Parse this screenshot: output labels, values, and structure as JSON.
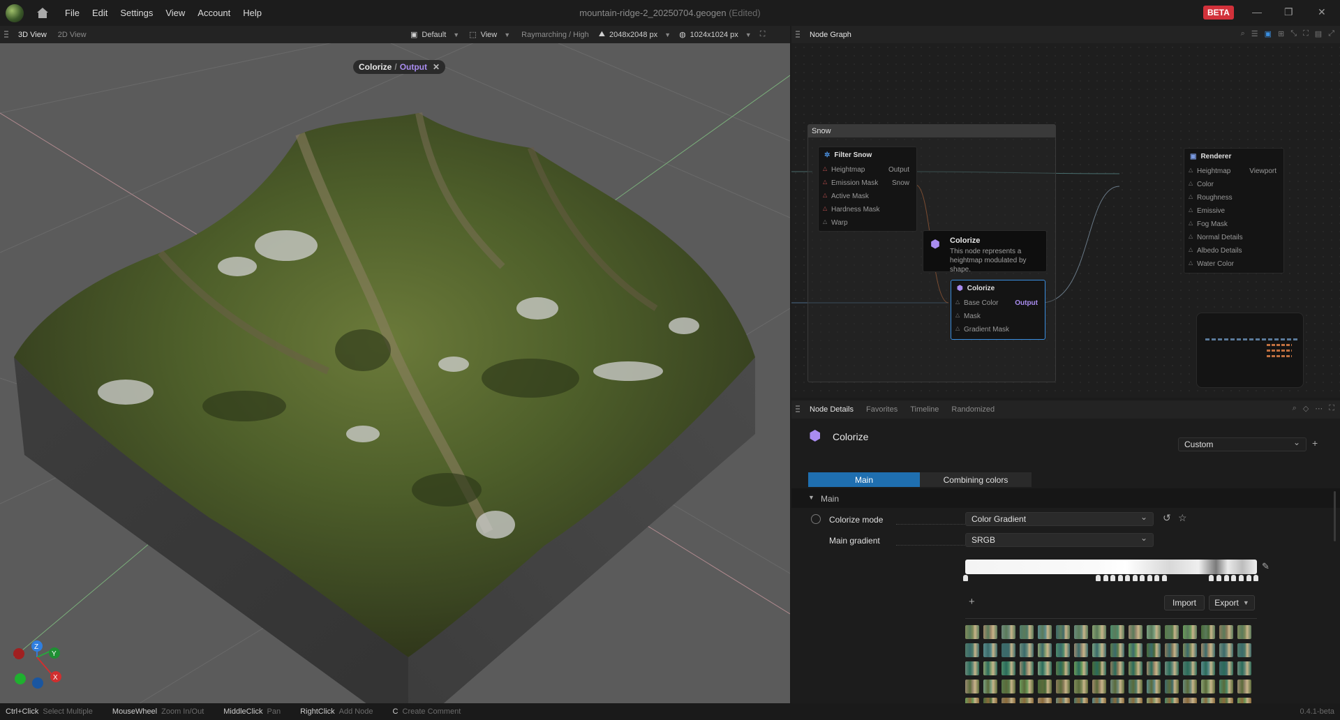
{
  "menu": {
    "items": [
      "File",
      "Edit",
      "Settings",
      "View",
      "Account",
      "Help"
    ]
  },
  "title": {
    "file": "mountain-ridge-2_20250704.geogen",
    "status": "(Edited)"
  },
  "badge": "BETA",
  "viewport": {
    "tabs": [
      "3D View",
      "2D View"
    ],
    "preset": "Default",
    "view": "View",
    "render_mode": "Raymarching / High",
    "resolution": "2048x2048 px",
    "output_res": "1024x1024 px",
    "chip": {
      "node": "Colorize",
      "sep": "/",
      "port": "Output"
    },
    "axes": {
      "z": "Z",
      "y": "Y",
      "x": "X"
    }
  },
  "nodegraph": {
    "tab": "Node Graph",
    "frame": "Snow",
    "filter_snow": {
      "title": "Filter Snow",
      "ports": [
        "Heightmap",
        "Emission Mask",
        "Active Mask",
        "Hardness Mask",
        "Warp"
      ],
      "outputs": [
        "Output",
        "Snow"
      ]
    },
    "tooltip": {
      "title": "Colorize",
      "desc": "This node represents a heightmap modulated by shape."
    },
    "colorize": {
      "title": "Colorize",
      "ports": [
        "Base Color",
        "Mask",
        "Gradient Mask"
      ],
      "output": "Output"
    },
    "renderer": {
      "title": "Renderer",
      "ports": [
        "Heightmap",
        "Color",
        "Roughness",
        "Emissive",
        "Fog Mask",
        "Normal Details",
        "Albedo Details",
        "Water Color"
      ],
      "output": "Viewport"
    }
  },
  "details": {
    "tabs": [
      "Node Details",
      "Favorites",
      "Timeline",
      "Randomized"
    ],
    "node_title": "Colorize",
    "preset": "Custom",
    "subtabs": [
      "Main",
      "Combining colors"
    ],
    "section": "Main",
    "colorize_mode_label": "Colorize mode",
    "colorize_mode": "Color Gradient",
    "main_gradient_label": "Main gradient",
    "main_gradient": "SRGB",
    "import": "Import",
    "export": "Export",
    "add": "+"
  },
  "statusbar": [
    {
      "key": "Ctrl+Click",
      "action": "Select Multiple"
    },
    {
      "key": "MouseWheel",
      "action": "Zoom In/Out"
    },
    {
      "key": "MiddleClick",
      "action": "Pan"
    },
    {
      "key": "RightClick",
      "action": "Add Node"
    },
    {
      "key": "C",
      "action": "Create Comment"
    }
  ],
  "version": "0.4.1-beta",
  "colors": {
    "accent": "#1f6fb0",
    "purple": "#a98cf0",
    "beta": "#d2313a"
  }
}
